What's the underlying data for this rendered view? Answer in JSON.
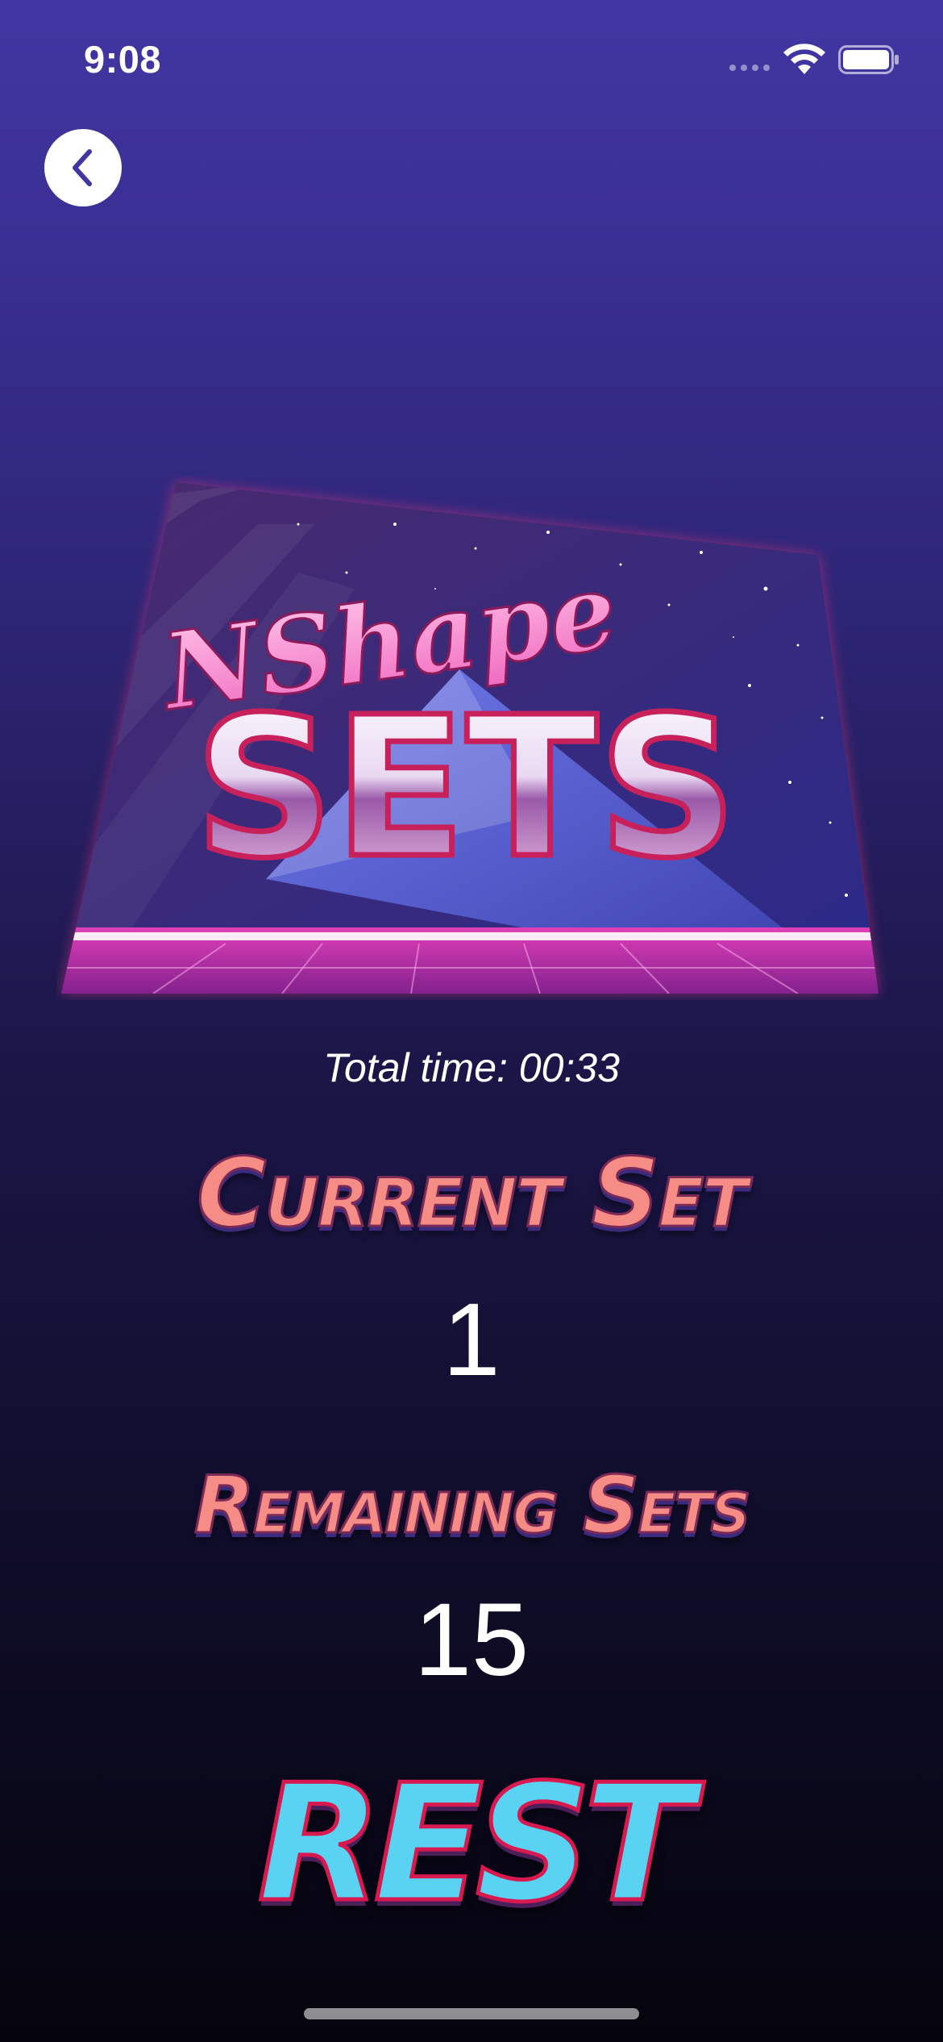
{
  "status_bar": {
    "time": "9:08",
    "icons": [
      "signal-dots-icon",
      "wifi-icon",
      "battery-icon"
    ]
  },
  "navigation": {
    "back_icon": "chevron-left-icon"
  },
  "logo": {
    "script_text": "NShape",
    "title_text": "SETS"
  },
  "workout": {
    "total_time": "Total time: 00:33",
    "current_set_label": "Current Set",
    "current_set_value": "1",
    "remaining_sets_label": "Remaining Sets",
    "remaining_sets_value": "15",
    "state_label": "REST"
  },
  "colors": {
    "background_top": "#4236a3",
    "background_bottom": "#05040d",
    "heading_pink": "#f58c86",
    "rest_blue": "#5ad3f2",
    "neon_pink": "#d8194f"
  }
}
